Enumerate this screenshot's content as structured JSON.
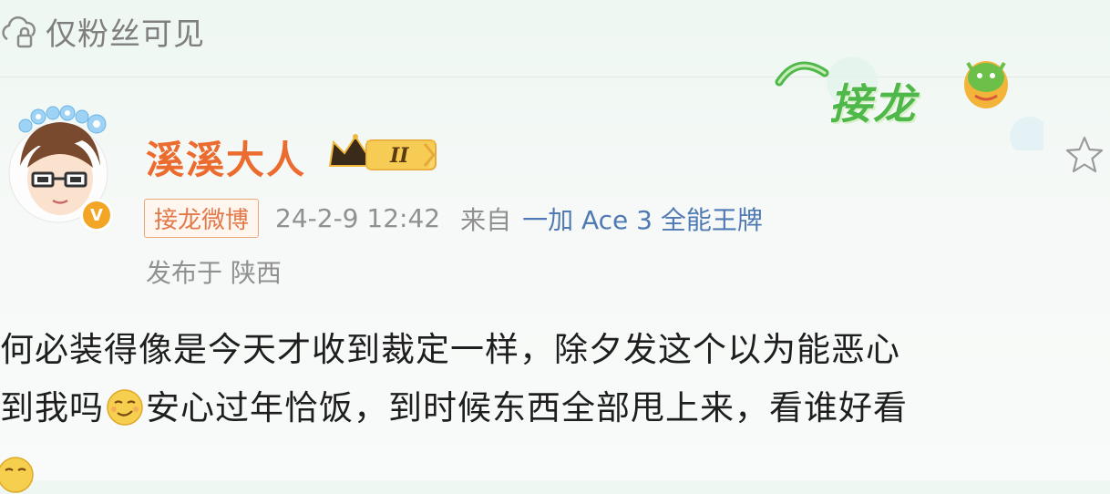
{
  "post": {
    "visibility_label": "仅粉丝可见",
    "author": {
      "name": "溪溪大人",
      "vip_level": "II"
    },
    "source_tag": "接龙微博",
    "timestamp": "24-2-9 12:42",
    "from_label": "来自",
    "device": "一加 Ace 3 全能王牌",
    "location": "发布于 陕西",
    "content": {
      "line1": "何必装得像是今天才收到裁定一样，除夕发这个以为能恶心",
      "line2_prefix": "到我吗",
      "line2_suffix": "安心过年恰饭，到时候东西全部甩上来，看谁好看"
    },
    "banner_text": "接龙"
  },
  "icons": {
    "lock": "lock-cloud-icon",
    "star": "star-outline-icon",
    "emoji": "smirk-emoji-icon"
  },
  "colors": {
    "username": "#ec6c2f",
    "device_link": "#4f7ab3",
    "meta_gray": "#909090",
    "verified": "#f3a626",
    "banner_green": "#4fb84a"
  }
}
